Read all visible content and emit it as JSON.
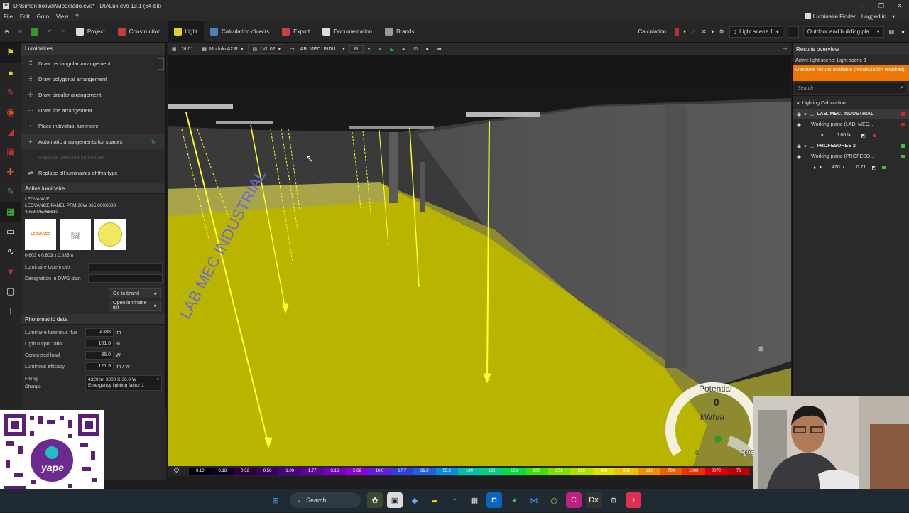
{
  "window": {
    "title": "D:\\Simon bolivar\\Modelado.evo* - DIALux evo 13.1 (64-bit)"
  },
  "menu": {
    "items": [
      "File",
      "Edit",
      "Goto",
      "View",
      "?"
    ],
    "luminaire_finder": "Luminaire Finder",
    "logged_in": "Logged in"
  },
  "toolbar": {
    "tabs": [
      "Project",
      "Construction",
      "Light",
      "Calculation objects",
      "Export",
      "Documentation",
      "Brands"
    ],
    "calculation_label": "Calculation",
    "light_scene": "Light scene 1",
    "mode": "Outdoor and building pla..."
  },
  "view_toolbar": {
    "storey": "LVL01",
    "module": "Modulo A2 R",
    "level": "LVL 02",
    "room": "LAB. MEC. INDU..."
  },
  "luminaires_panel": {
    "title": "Luminaires",
    "commands": [
      {
        "label": "Draw rectangular arrangement",
        "enabled": true
      },
      {
        "label": "Draw polygonal arrangement",
        "enabled": true
      },
      {
        "label": "Draw circular arrangement",
        "enabled": true
      },
      {
        "label": "Draw line arrangement",
        "enabled": true
      },
      {
        "label": "Place individual luminaire",
        "enabled": true
      },
      {
        "label": "Automatic arrangements for spaces",
        "enabled": true
      },
      {
        "label": "Replace selected luminaires",
        "enabled": false
      },
      {
        "label": "Replace all luminaires of this type",
        "enabled": true
      }
    ]
  },
  "active_luminaire": {
    "title": "Active luminaire",
    "manufacturer": "LEDVANCE",
    "product": "LEDVANCE PANEL PFM 36W 865 600X600",
    "article": "4058075765610",
    "brand_logo": "LEDVANCE",
    "dimensions": "0.603 x 0.603 x 0.035m",
    "type_index_label": "Luminaire type index",
    "dwg_label": "Designation in DWG plan",
    "go_to_brand": "Go to brand",
    "open_list": "Open luminaire list"
  },
  "photometric": {
    "title": "Photometric data",
    "rows": [
      {
        "label": "Luminaire luminous flux",
        "value": "4388",
        "unit": "lm"
      },
      {
        "label": "Light output ratio",
        "value": "101.6",
        "unit": "%"
      },
      {
        "label": "Connected load",
        "value": "36.0",
        "unit": "W"
      },
      {
        "label": "Luminous efficacy",
        "value": "121.9",
        "unit": "lm / W"
      }
    ],
    "fitting_label": "Fitting",
    "change_label": "Change",
    "fitting_line1": "4320 lm  3000 K  36.0 W",
    "fitting_line2": "Emergency lighting factor 1"
  },
  "results": {
    "title": "Results overview",
    "active_scene": "Active light scene: Light scene 1",
    "warning": "Obsolete results available (recalculation required)",
    "search_placeholder": "Search",
    "tree": [
      {
        "label": "Lighting Calculation",
        "indent": 0
      },
      {
        "label": "LAB. MEC. INDUSTRIAL",
        "indent": 1,
        "status": "#e02020"
      },
      {
        "label": "Working plane (LAB. MEC...",
        "indent": 2,
        "status": "#e02020"
      },
      {
        "label": "0.00 lx",
        "indent": 3,
        "status": "#e02020"
      },
      {
        "label": "PROFESORES 2",
        "indent": 1,
        "status": "#40c040"
      },
      {
        "label": "Working plane (PROFESO...",
        "indent": 2,
        "status": "#40c040"
      },
      {
        "label": "420 lx",
        "value": "0.71",
        "indent": 3,
        "status": "#40c040"
      }
    ]
  },
  "potential": {
    "label": "Potential",
    "value": "0",
    "unit": "kWh/a",
    "min": "0",
    "max": "2693"
  },
  "scale": {
    "labels": [
      "0.10",
      "0.18",
      "0.32",
      "0.56",
      "1.00",
      "1.77",
      "3.16",
      "5.62",
      "10.0",
      "17.7",
      "31.6",
      "56.2",
      "100",
      "125",
      "158",
      "200",
      "251",
      "316",
      "398",
      "501",
      "630",
      "794",
      "1000",
      "3872",
      "76"
    ],
    "colors": [
      "#000010",
      "#10002a",
      "#2a0040",
      "#3a0060",
      "#4a0080",
      "#6000a0",
      "#7a00c0",
      "#9000d8",
      "#6020e0",
      "#3040e0",
      "#2060e0",
      "#0090e0",
      "#00c0b0",
      "#00d080",
      "#00e040",
      "#40e000",
      "#80e000",
      "#b0e000",
      "#e0e000",
      "#f0c000",
      "#f09000",
      "#f06000",
      "#f03000",
      "#e00000",
      "#c00000"
    ]
  },
  "taskbar": {
    "search": "Search"
  },
  "qr": {
    "brand": "yape"
  },
  "colors": {
    "accent": "#f07800",
    "floor": "#b8b400",
    "light_ray": "#ffff30"
  }
}
